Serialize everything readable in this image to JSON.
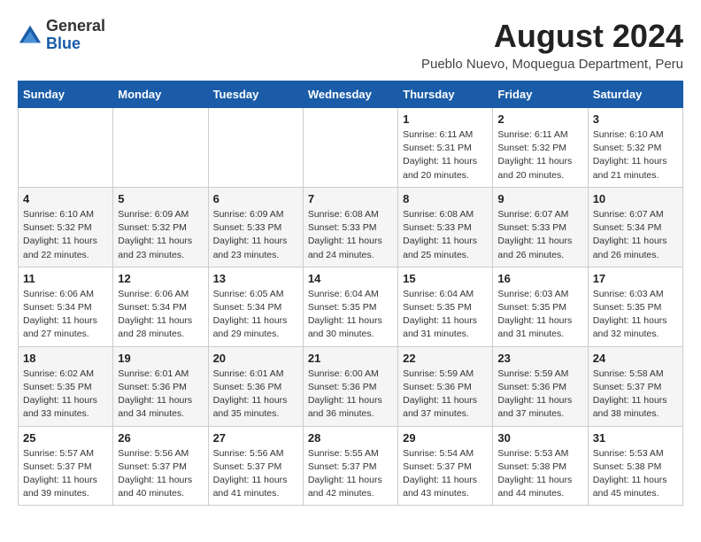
{
  "logo": {
    "general": "General",
    "blue": "Blue"
  },
  "title": {
    "month_year": "August 2024",
    "location": "Pueblo Nuevo, Moquegua Department, Peru"
  },
  "weekdays": [
    "Sunday",
    "Monday",
    "Tuesday",
    "Wednesday",
    "Thursday",
    "Friday",
    "Saturday"
  ],
  "weeks": [
    [
      {
        "day": "",
        "info": ""
      },
      {
        "day": "",
        "info": ""
      },
      {
        "day": "",
        "info": ""
      },
      {
        "day": "",
        "info": ""
      },
      {
        "day": "1",
        "info": "Sunrise: 6:11 AM\nSunset: 5:31 PM\nDaylight: 11 hours\nand 20 minutes."
      },
      {
        "day": "2",
        "info": "Sunrise: 6:11 AM\nSunset: 5:32 PM\nDaylight: 11 hours\nand 20 minutes."
      },
      {
        "day": "3",
        "info": "Sunrise: 6:10 AM\nSunset: 5:32 PM\nDaylight: 11 hours\nand 21 minutes."
      }
    ],
    [
      {
        "day": "4",
        "info": "Sunrise: 6:10 AM\nSunset: 5:32 PM\nDaylight: 11 hours\nand 22 minutes."
      },
      {
        "day": "5",
        "info": "Sunrise: 6:09 AM\nSunset: 5:32 PM\nDaylight: 11 hours\nand 23 minutes."
      },
      {
        "day": "6",
        "info": "Sunrise: 6:09 AM\nSunset: 5:33 PM\nDaylight: 11 hours\nand 23 minutes."
      },
      {
        "day": "7",
        "info": "Sunrise: 6:08 AM\nSunset: 5:33 PM\nDaylight: 11 hours\nand 24 minutes."
      },
      {
        "day": "8",
        "info": "Sunrise: 6:08 AM\nSunset: 5:33 PM\nDaylight: 11 hours\nand 25 minutes."
      },
      {
        "day": "9",
        "info": "Sunrise: 6:07 AM\nSunset: 5:33 PM\nDaylight: 11 hours\nand 26 minutes."
      },
      {
        "day": "10",
        "info": "Sunrise: 6:07 AM\nSunset: 5:34 PM\nDaylight: 11 hours\nand 26 minutes."
      }
    ],
    [
      {
        "day": "11",
        "info": "Sunrise: 6:06 AM\nSunset: 5:34 PM\nDaylight: 11 hours\nand 27 minutes."
      },
      {
        "day": "12",
        "info": "Sunrise: 6:06 AM\nSunset: 5:34 PM\nDaylight: 11 hours\nand 28 minutes."
      },
      {
        "day": "13",
        "info": "Sunrise: 6:05 AM\nSunset: 5:34 PM\nDaylight: 11 hours\nand 29 minutes."
      },
      {
        "day": "14",
        "info": "Sunrise: 6:04 AM\nSunset: 5:35 PM\nDaylight: 11 hours\nand 30 minutes."
      },
      {
        "day": "15",
        "info": "Sunrise: 6:04 AM\nSunset: 5:35 PM\nDaylight: 11 hours\nand 31 minutes."
      },
      {
        "day": "16",
        "info": "Sunrise: 6:03 AM\nSunset: 5:35 PM\nDaylight: 11 hours\nand 31 minutes."
      },
      {
        "day": "17",
        "info": "Sunrise: 6:03 AM\nSunset: 5:35 PM\nDaylight: 11 hours\nand 32 minutes."
      }
    ],
    [
      {
        "day": "18",
        "info": "Sunrise: 6:02 AM\nSunset: 5:35 PM\nDaylight: 11 hours\nand 33 minutes."
      },
      {
        "day": "19",
        "info": "Sunrise: 6:01 AM\nSunset: 5:36 PM\nDaylight: 11 hours\nand 34 minutes."
      },
      {
        "day": "20",
        "info": "Sunrise: 6:01 AM\nSunset: 5:36 PM\nDaylight: 11 hours\nand 35 minutes."
      },
      {
        "day": "21",
        "info": "Sunrise: 6:00 AM\nSunset: 5:36 PM\nDaylight: 11 hours\nand 36 minutes."
      },
      {
        "day": "22",
        "info": "Sunrise: 5:59 AM\nSunset: 5:36 PM\nDaylight: 11 hours\nand 37 minutes."
      },
      {
        "day": "23",
        "info": "Sunrise: 5:59 AM\nSunset: 5:36 PM\nDaylight: 11 hours\nand 37 minutes."
      },
      {
        "day": "24",
        "info": "Sunrise: 5:58 AM\nSunset: 5:37 PM\nDaylight: 11 hours\nand 38 minutes."
      }
    ],
    [
      {
        "day": "25",
        "info": "Sunrise: 5:57 AM\nSunset: 5:37 PM\nDaylight: 11 hours\nand 39 minutes."
      },
      {
        "day": "26",
        "info": "Sunrise: 5:56 AM\nSunset: 5:37 PM\nDaylight: 11 hours\nand 40 minutes."
      },
      {
        "day": "27",
        "info": "Sunrise: 5:56 AM\nSunset: 5:37 PM\nDaylight: 11 hours\nand 41 minutes."
      },
      {
        "day": "28",
        "info": "Sunrise: 5:55 AM\nSunset: 5:37 PM\nDaylight: 11 hours\nand 42 minutes."
      },
      {
        "day": "29",
        "info": "Sunrise: 5:54 AM\nSunset: 5:37 PM\nDaylight: 11 hours\nand 43 minutes."
      },
      {
        "day": "30",
        "info": "Sunrise: 5:53 AM\nSunset: 5:38 PM\nDaylight: 11 hours\nand 44 minutes."
      },
      {
        "day": "31",
        "info": "Sunrise: 5:53 AM\nSunset: 5:38 PM\nDaylight: 11 hours\nand 45 minutes."
      }
    ]
  ]
}
